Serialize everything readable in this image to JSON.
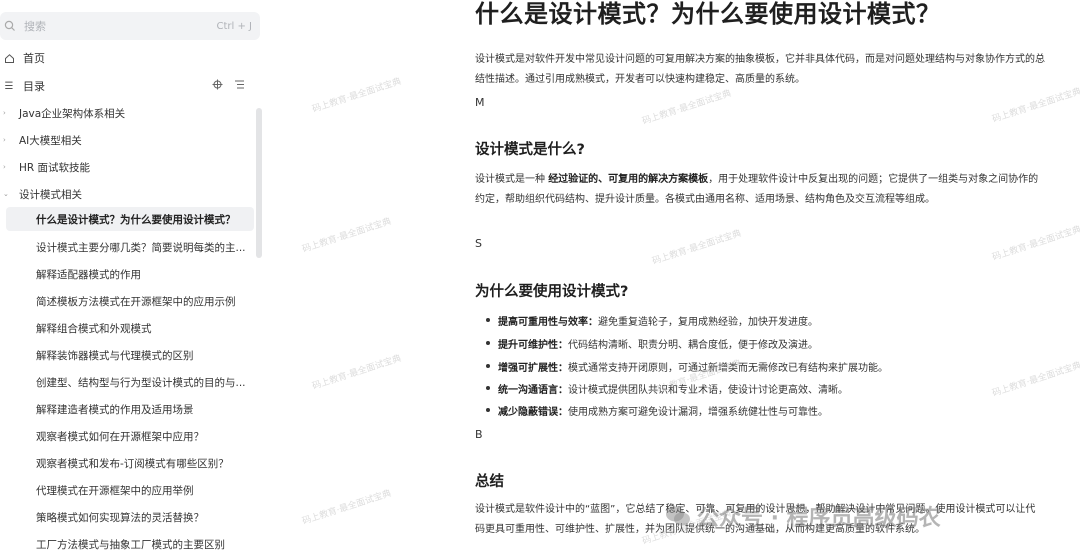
{
  "sidebar": {
    "search": {
      "placeholder": "搜索",
      "shortcut": "Ctrl + J"
    },
    "home_label": "首页",
    "toc_label": "目录",
    "categories": [
      "Java企业架构体系相关",
      "AI大模型相关",
      "HR 面试软技能",
      "设计模式相关"
    ],
    "items": [
      "什么是设计模式？为什么要使用设计模式？",
      "设计模式主要分哪几类？简要说明每类的主...",
      "解释适配器模式的作用",
      "简述模板方法模式在开源框架中的应用示例",
      "解释组合模式和外观模式",
      "解释装饰器模式与代理模式的区别",
      "创建型、结构型与行为型设计模式的目的与...",
      "解释建造者模式的作用及适用场景",
      "观察者模式如何在开源框架中应用？",
      "观察者模式和发布-订阅模式有哪些区别？",
      "代理模式在开源框架中的应用举例",
      "策略模式如何实现算法的灵活替换？",
      "工厂方法模式与抽象工厂模式的主要区别"
    ]
  },
  "article": {
    "title": "什么是设计模式？为什么要使用设计模式？",
    "intro": "设计模式是对软件开发中常见设计问题的可复用解决方案的抽象模板，它并非具体代码，而是对问题处理结构与对象协作方式的总结性描述。通过引用成熟模式，开发者可以快速构建稳定、高质量的系统。",
    "mark1": "M",
    "section1_title": "设计模式是什么?",
    "section1_pre": "设计模式是一种 ",
    "section1_bold": "经过验证的、可复用的解决方案模板",
    "section1_post": "，用于处理软件设计中反复出现的问题；它提供了一组类与对象之间协作的约定，帮助组织代码结构、提升设计质量。各模式由通用名称、适用场景、结构角色及交互流程等组成。",
    "mark2": "S",
    "section2_title": "为什么要使用设计模式?",
    "bullets": [
      {
        "term": "提高可重用性与效率：",
        "text": "避免重复造轮子，复用成熟经验，加快开发进度。"
      },
      {
        "term": "提升可维护性：",
        "text": "代码结构清晰、职责分明、耦合度低，便于修改及演进。"
      },
      {
        "term": "增强可扩展性：",
        "text": "模式通常支持开闭原则，可通过新增类而无需修改已有结构来扩展功能。"
      },
      {
        "term": "统一沟通语言：",
        "text": "设计模式提供团队共识和专业术语，使设计讨论更高效、清晰。"
      },
      {
        "term": "减少隐蔽错误：",
        "text": "使用成熟方案可避免设计漏洞，增强系统健壮性与可靠性。"
      }
    ],
    "mark3": "B",
    "section3_title": "总结",
    "summary": "设计模式是软件设计中的“蓝图”，它总结了稳定、可靠、可复用的设计思想，帮助解决设计中常见问题。使用设计模式可以让代码更具可重用性、可维护性、扩展性，并为团队提供统一的沟通基础，从而构建更高质量的软件系统。"
  },
  "overlay": {
    "watermark": "码上教育·最全面试宝典",
    "wechat_text": "公众号 · 程序员高级码农"
  }
}
